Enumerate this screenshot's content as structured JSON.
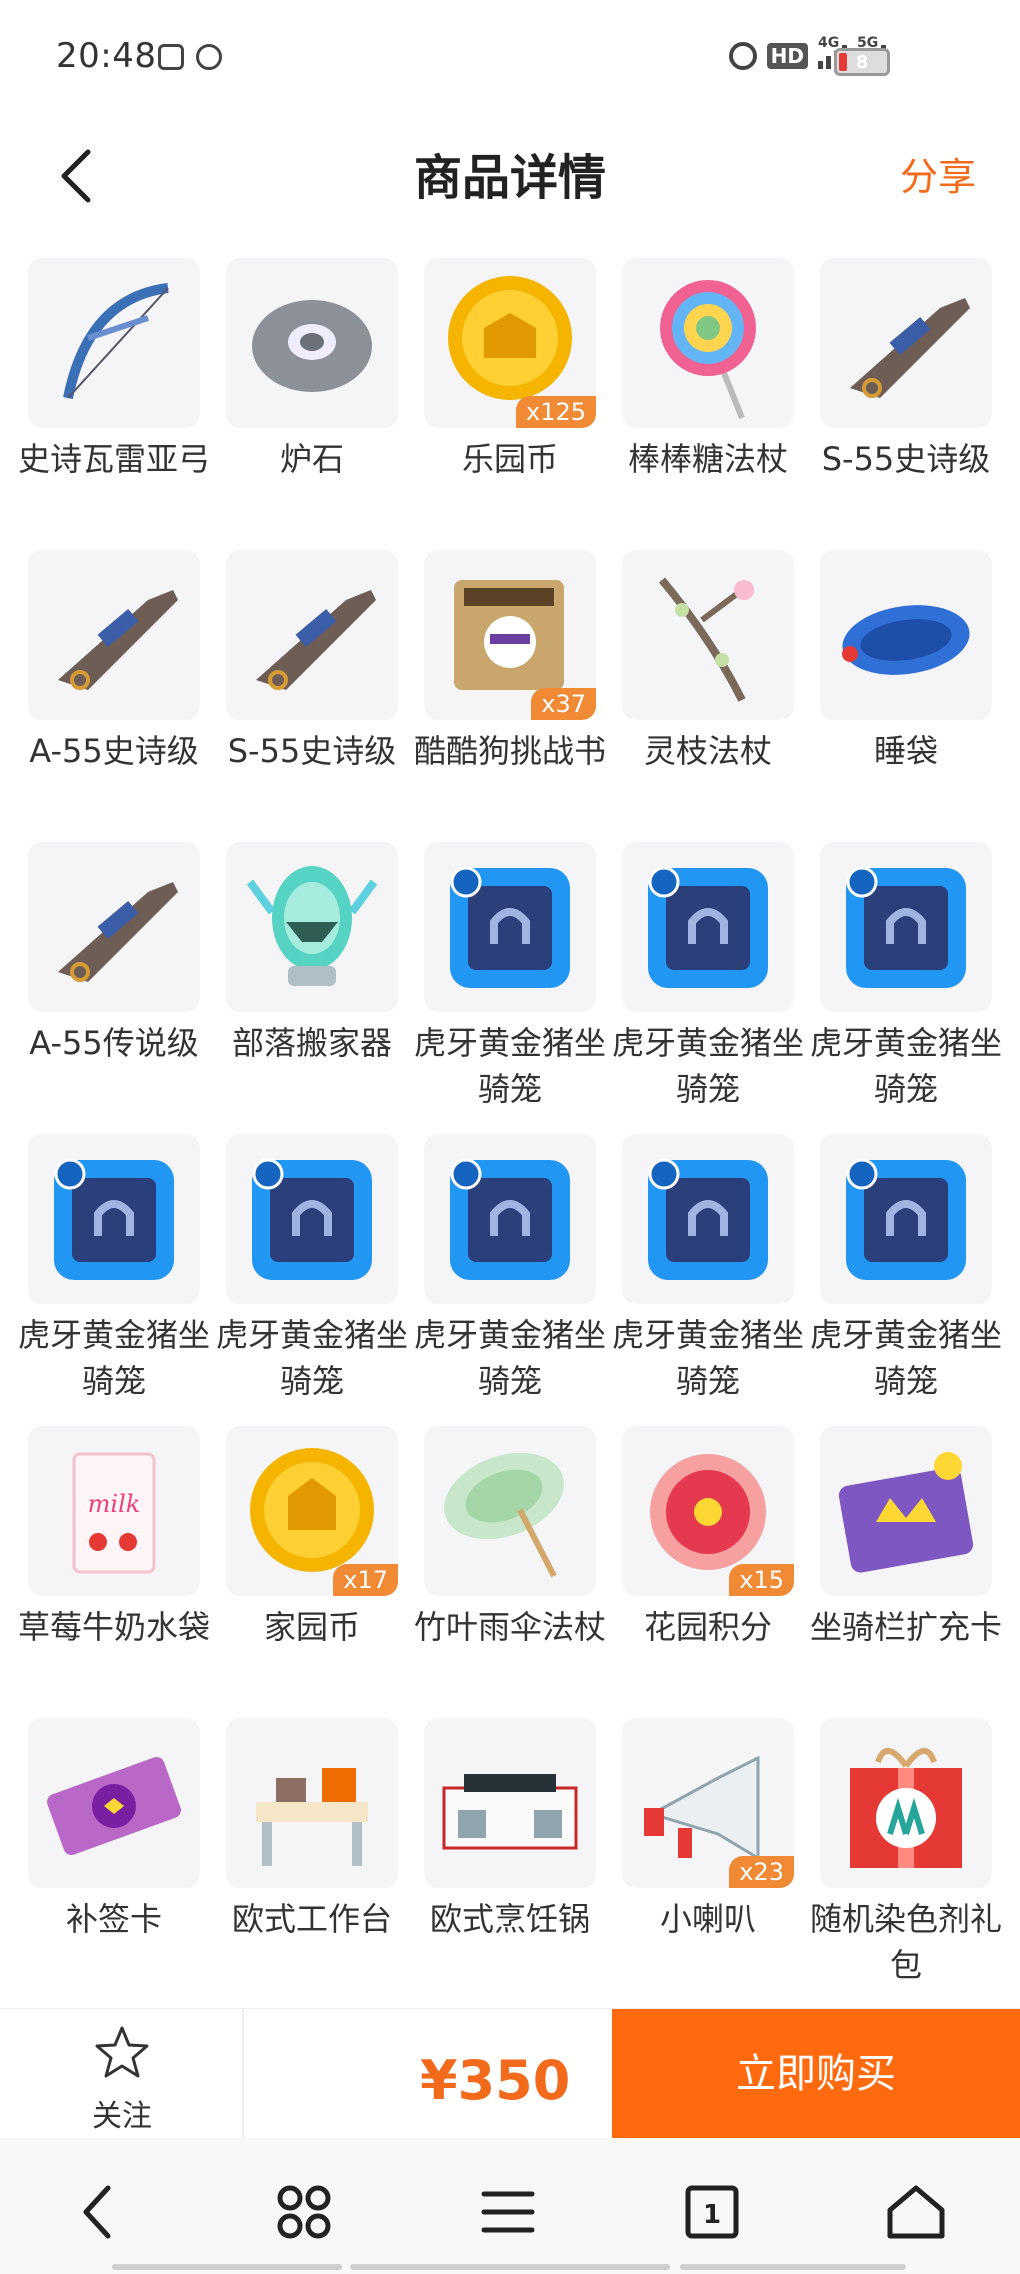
{
  "status_bar": {
    "time": "20:48",
    "battery": "8",
    "network_1": "4G",
    "network_2": "5G",
    "hd": "HD"
  },
  "header": {
    "title": "商品详情",
    "share": "分享"
  },
  "items": [
    {
      "name": "史诗瓦雷亚弓",
      "icon": "bow-icon",
      "qty": ""
    },
    {
      "name": "炉石",
      "icon": "hearthstone-icon",
      "qty": ""
    },
    {
      "name": "乐园币",
      "icon": "gold-coin-icon",
      "qty": "x125"
    },
    {
      "name": "棒棒糖法杖",
      "icon": "lollipop-icon",
      "qty": ""
    },
    {
      "name": "S-55史诗级",
      "icon": "rifle-icon",
      "qty": ""
    },
    {
      "name": "A-55史诗级",
      "icon": "rifle-icon",
      "qty": ""
    },
    {
      "name": "S-55史诗级",
      "icon": "rifle-icon",
      "qty": ""
    },
    {
      "name": "酷酷狗挑战书",
      "icon": "wanted-poster-icon",
      "qty": "x37"
    },
    {
      "name": "灵枝法杖",
      "icon": "branch-icon",
      "qty": ""
    },
    {
      "name": "睡袋",
      "icon": "sleeping-bag-icon",
      "qty": ""
    },
    {
      "name": "A-55传说级",
      "icon": "rifle-icon",
      "qty": ""
    },
    {
      "name": "部落搬家器",
      "icon": "egg-capsule-icon",
      "qty": ""
    },
    {
      "name": "虎牙黄金猪坐骑笼",
      "icon": "mount-cage-icon",
      "qty": ""
    },
    {
      "name": "虎牙黄金猪坐骑笼",
      "icon": "mount-cage-icon",
      "qty": ""
    },
    {
      "name": "虎牙黄金猪坐骑笼",
      "icon": "mount-cage-icon",
      "qty": ""
    },
    {
      "name": "虎牙黄金猪坐骑笼",
      "icon": "mount-cage-icon",
      "qty": ""
    },
    {
      "name": "虎牙黄金猪坐骑笼",
      "icon": "mount-cage-icon",
      "qty": ""
    },
    {
      "name": "虎牙黄金猪坐骑笼",
      "icon": "mount-cage-icon",
      "qty": ""
    },
    {
      "name": "虎牙黄金猪坐骑笼",
      "icon": "mount-cage-icon",
      "qty": ""
    },
    {
      "name": "虎牙黄金猪坐骑笼",
      "icon": "mount-cage-icon",
      "qty": ""
    },
    {
      "name": "草莓牛奶水袋",
      "icon": "milk-pouch-icon",
      "qty": ""
    },
    {
      "name": "家园币",
      "icon": "home-coin-icon",
      "qty": "x17"
    },
    {
      "name": "竹叶雨伞法杖",
      "icon": "umbrella-icon",
      "qty": ""
    },
    {
      "name": "花园积分",
      "icon": "flower-icon",
      "qty": "x15"
    },
    {
      "name": "坐骑栏扩充卡",
      "icon": "expansion-card-icon",
      "qty": ""
    },
    {
      "name": "补签卡",
      "icon": "ticket-icon",
      "qty": ""
    },
    {
      "name": "欧式工作台",
      "icon": "workbench-icon",
      "qty": ""
    },
    {
      "name": "欧式烹饪锅",
      "icon": "stove-icon",
      "qty": ""
    },
    {
      "name": "小喇叭",
      "icon": "megaphone-icon",
      "qty": "x23"
    },
    {
      "name": "随机染色剂礼包",
      "icon": "gift-box-icon",
      "qty": ""
    }
  ],
  "action_bar": {
    "follow_label": "关注",
    "price": "¥350",
    "buy_label": "立即购买"
  },
  "colors": {
    "accent": "#ff6a0e",
    "price": "#f26b1d",
    "qty_badge": "#f08a34"
  }
}
